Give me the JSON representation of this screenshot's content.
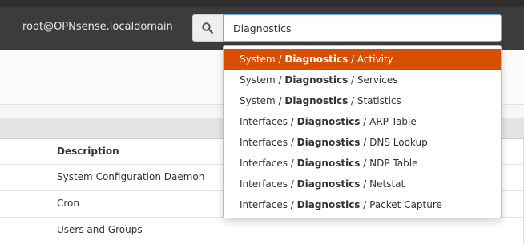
{
  "topbar": {
    "user": "root@OPNsense.localdomain",
    "search_value": "Diagnostics"
  },
  "table": {
    "column_header": "Description",
    "rows": [
      "System Configuration Daemon",
      "Cron",
      "Users and Groups"
    ]
  },
  "dropdown": {
    "items": [
      {
        "prefix": "System / ",
        "match": "Diagnostics",
        "suffix": " / Activity",
        "active": true
      },
      {
        "prefix": "System / ",
        "match": "Diagnostics",
        "suffix": " / Services"
      },
      {
        "prefix": "System / ",
        "match": "Diagnostics",
        "suffix": " / Statistics"
      },
      {
        "prefix": "Interfaces / ",
        "match": "Diagnostics",
        "suffix": " / ARP Table"
      },
      {
        "prefix": "Interfaces / ",
        "match": "Diagnostics",
        "suffix": " / DNS Lookup"
      },
      {
        "prefix": "Interfaces / ",
        "match": "Diagnostics",
        "suffix": " / NDP Table"
      },
      {
        "prefix": "Interfaces / ",
        "match": "Diagnostics",
        "suffix": " / Netstat"
      },
      {
        "prefix": "Interfaces / ",
        "match": "Diagnostics",
        "suffix": " / Packet Capture"
      }
    ]
  },
  "colors": {
    "accent": "#d94f00",
    "topbar": "#3c3c3c",
    "play_button": "#8bc34a"
  },
  "icons": [
    "search-icon",
    "play-icon",
    "restart-icon"
  ]
}
